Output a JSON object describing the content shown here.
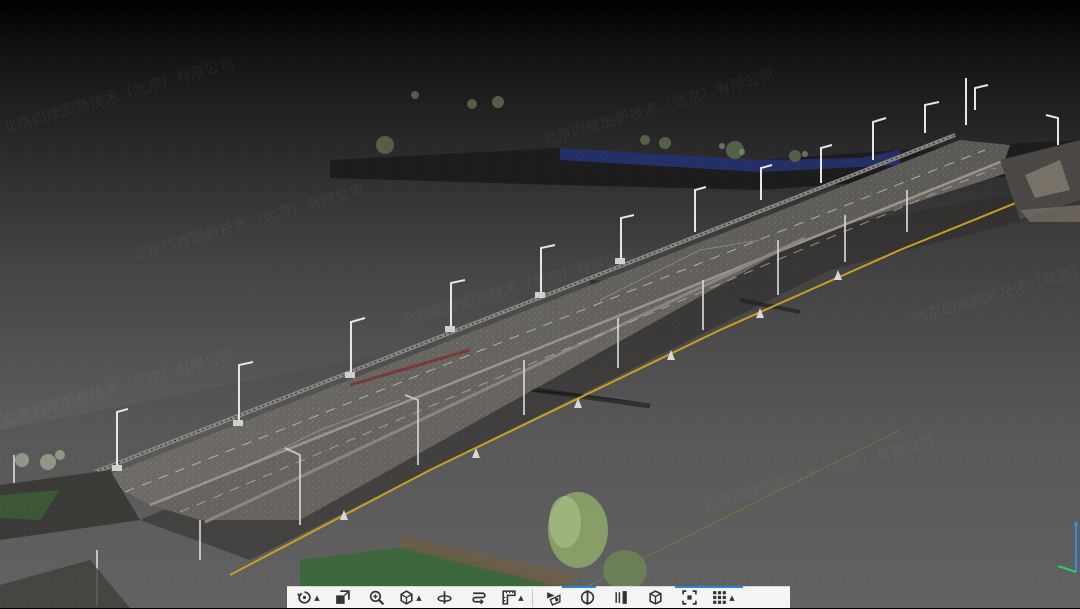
{
  "viewport": {
    "description_hidden": "",
    "background_top": "#000000",
    "background_bottom": "#666666"
  },
  "watermark": {
    "text": "北京四维图新技术（北京）有限公司"
  },
  "colors": {
    "accent": "#1e88e5",
    "toolbar_bg": "#f4f4f4",
    "lane_line": "#c8a020",
    "road": "#7a746c",
    "streetlight": "#e6e6e6",
    "fence_blue": "#3050c8"
  },
  "toolbar": {
    "items": [
      {
        "icon": "orbit-rotate-icon",
        "has_menu": true
      },
      {
        "icon": "layers-cube-icon",
        "has_menu": false
      },
      {
        "icon": "zoom-icon",
        "has_menu": false
      },
      {
        "icon": "view-cube-icon",
        "has_menu": true
      },
      {
        "icon": "turntable-icon",
        "has_menu": false
      },
      {
        "icon": "walk-path-icon",
        "has_menu": false
      },
      {
        "icon": "measure-tool-icon",
        "has_menu": true
      },
      {
        "icon": "section-cut-icon",
        "has_menu": false
      },
      {
        "icon": "clip-plane-icon",
        "has_menu": false
      },
      {
        "icon": "slice-icon",
        "has_menu": false
      },
      {
        "icon": "3d-box-icon",
        "has_menu": false
      },
      {
        "icon": "fit-extents-icon",
        "has_menu": false
      },
      {
        "icon": "grid-menu-icon",
        "has_menu": true
      }
    ]
  }
}
